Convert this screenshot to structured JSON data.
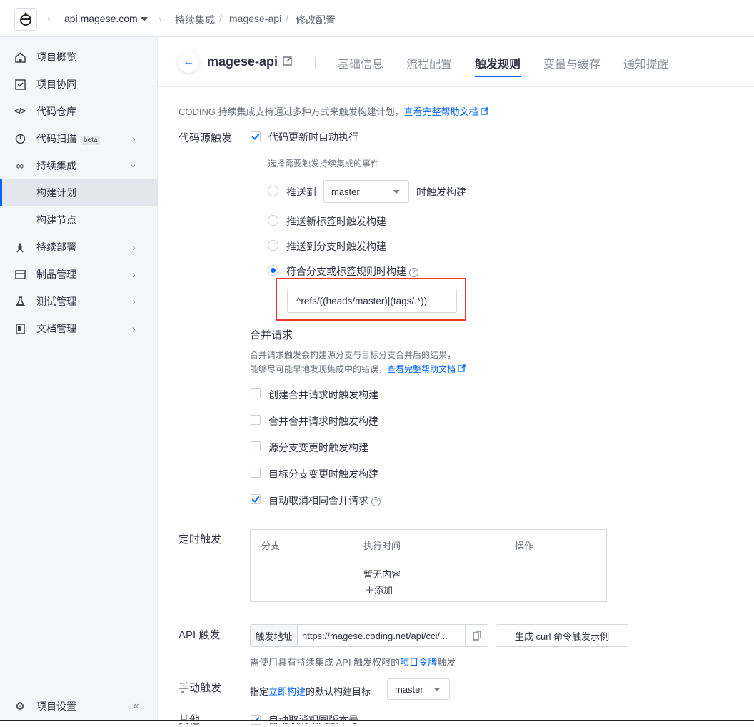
{
  "topbar": {
    "domain": "api.magese.com",
    "breadcrumb": [
      "持续集成",
      "magese-api",
      "修改配置"
    ]
  },
  "sidebar": {
    "items": [
      {
        "label": "项目概览",
        "icon": "home-icon"
      },
      {
        "label": "项目协同",
        "icon": "checklist-icon"
      },
      {
        "label": "代码仓库",
        "icon": "code-icon"
      },
      {
        "label": "代码扫描",
        "icon": "scan-icon",
        "badge": "beta"
      },
      {
        "label": "持续集成",
        "icon": "infinity-icon"
      },
      {
        "label": "构建计划"
      },
      {
        "label": "构建节点"
      },
      {
        "label": "持续部署",
        "icon": "rocket-icon"
      },
      {
        "label": "制品管理",
        "icon": "box-icon"
      },
      {
        "label": "测试管理",
        "icon": "flask-icon"
      },
      {
        "label": "文档管理",
        "icon": "document-icon"
      }
    ],
    "settings_label": "项目设置"
  },
  "header": {
    "project_name": "magese-api",
    "tabs": [
      "基础信息",
      "流程配置",
      "触发规则",
      "变量与缓存",
      "通知提醒"
    ],
    "active_tab": "触发规则"
  },
  "intro": {
    "text": "CODING 持续集成支持通过多种方式来触发构建计划，",
    "link": "查看完整帮助文档"
  },
  "code_trigger": {
    "label": "代码源触发",
    "auto_exec": "代码更新时自动执行",
    "event_hint": "选择需要触发持续集成的事件",
    "push_to": "推送到",
    "push_branch": "master",
    "push_suffix": "时触发构建",
    "new_tag": "推送新标签时触发构建",
    "push_branch_any": "推送到分支时触发构建",
    "match_rule": "符合分支或标签规则时构建",
    "rule_value": "^refs/((heads/master)|(tags/.*))"
  },
  "merge_request": {
    "title": "合并请求",
    "desc1": "合并请求触发会构建源分支与目标分支合并后的结果，",
    "desc2": "能够尽可能早地发现集成中的错误，",
    "link": "查看完整帮助文档",
    "options": [
      "创建合并请求时触发构建",
      "合并合并请求时触发构建",
      "源分支变更时触发构建",
      "目标分支变更时触发构建",
      "自动取消相同合并请求"
    ]
  },
  "schedule": {
    "label": "定时触发",
    "columns": [
      "分支",
      "执行时间",
      "操作"
    ],
    "empty": "暂无内容",
    "add": "添加"
  },
  "api": {
    "label": "API 触发",
    "addr_label": "触发地址",
    "url": "https://magese.coding.net/api/cci/...",
    "button": "生成 curl 命令触发示例",
    "note_prefix": "需使用具有持续集成 API 触发权限的",
    "note_link": "项目令牌",
    "note_suffix": "触发"
  },
  "manual": {
    "label": "手动触发",
    "prefix": "指定",
    "link": "立即构建",
    "suffix": "的默认构建目标",
    "branch": "master"
  },
  "other": {
    "label": "其他",
    "option": "自动取消相同版本号"
  },
  "colors": {
    "accent": "#0066ff",
    "highlight": "#e53935"
  }
}
